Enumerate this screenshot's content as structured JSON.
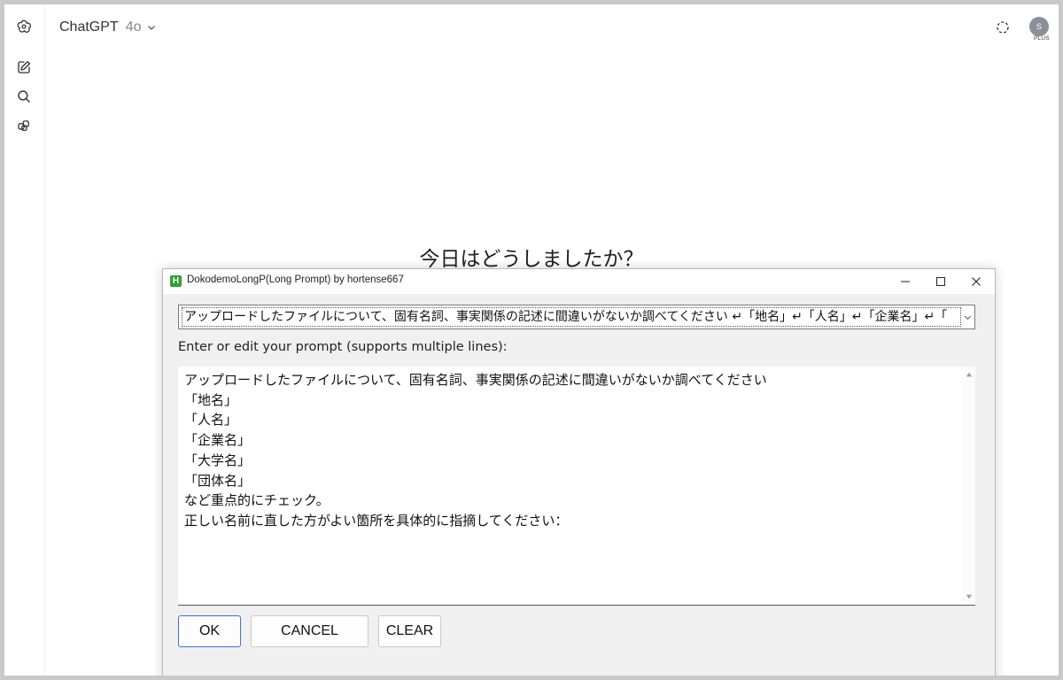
{
  "app": {
    "model_name": "ChatGPT",
    "model_version": "4o",
    "avatar_initial": "S",
    "plan_badge": "PLUS",
    "greeting": "今日はどうしましたか？"
  },
  "sidebar": {
    "icons": [
      "new-chat-icon",
      "search-icon",
      "gpts-icon"
    ]
  },
  "dialog": {
    "window_title": "DokodemoLongP(Long Prompt) by hortense667",
    "app_icon_letter": "H",
    "combo_value": "アップロードしたファイルについて、固有名詞、事実関係の記述に間違いがないか調べてください ↵「地名」↵「人名」↵「企業名」↵「",
    "prompt_label": "Enter or edit your prompt (supports multiple lines):",
    "prompt_text": "アップロードしたファイルについて、固有名詞、事実関係の記述に間違いがないか調べてください\n「地名」\n「人名」\n「企業名」\n「大学名」\n「団体名」\nなど重点的にチェック。\n正しい名前に直した方がよい箇所を具体的に指摘してください：",
    "buttons": {
      "ok": "OK",
      "cancel": "CANCEL",
      "clear": "CLEAR"
    }
  },
  "colors": {
    "accent_border": "#3f6fcf",
    "app_icon_green": "#2f9e3a"
  }
}
